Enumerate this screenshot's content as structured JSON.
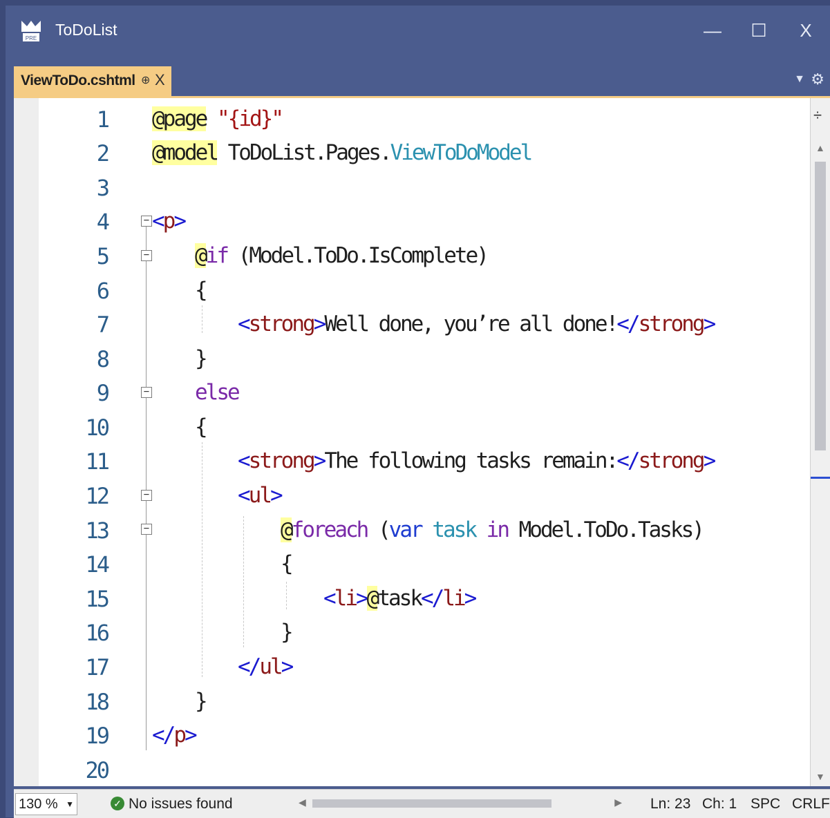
{
  "window": {
    "title": "ToDoList"
  },
  "tab": {
    "label": "ViewToDo.cshtml",
    "pin": "⊕",
    "close": "X"
  },
  "controls": {
    "minimize": "—",
    "maximize": "☐",
    "close": "X"
  },
  "editor": {
    "line_numbers": [
      "1",
      "2",
      "3",
      "4",
      "5",
      "6",
      "7",
      "8",
      "9",
      "10",
      "11",
      "12",
      "13",
      "14",
      "15",
      "16",
      "17",
      "18",
      "19",
      "20"
    ]
  },
  "status": {
    "zoom": "130 %",
    "issues": "No issues found",
    "line": "Ln: 23",
    "col": "Ch: 1",
    "spacing": "SPC",
    "line_ending": "CRLF"
  },
  "colors": {
    "tab_active": "#f5cc84",
    "titlebar": "#4b5c8e",
    "tag": "#1a1ad0",
    "razor_highlight": "#ffffa0"
  }
}
